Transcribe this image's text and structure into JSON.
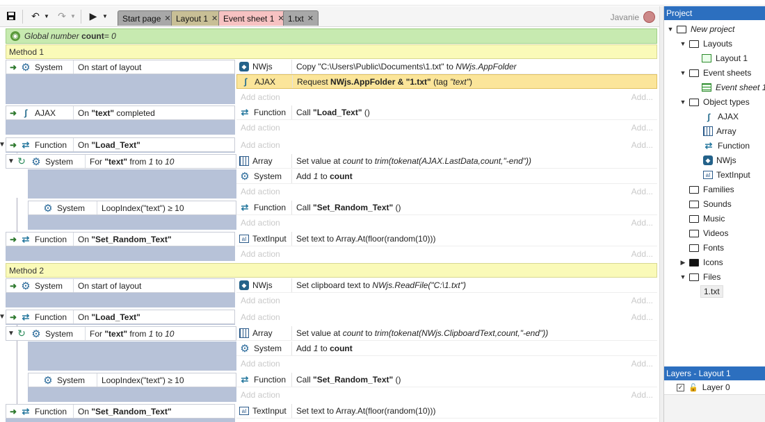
{
  "user": {
    "name": "Javanie"
  },
  "tabs": [
    {
      "label": "Start page"
    },
    {
      "label": "Layout 1"
    },
    {
      "label": "Event sheet 1"
    },
    {
      "label": "1.txt"
    }
  ],
  "global": {
    "prefix": "Global number ",
    "name": "count",
    "suffix": " = 0"
  },
  "add_action": "Add action",
  "add_more": "Add...",
  "groups": {
    "g1": "Method 1",
    "g2": "Method 2"
  },
  "objects": {
    "system": "System",
    "ajax": "AJAX",
    "function": "Function",
    "nwjs": "NWjs",
    "array": "Array",
    "textinput": "TextInput"
  },
  "m1": {
    "e1": {
      "cond": "On start of layout",
      "a1_pre": "Copy \"C:\\Users\\Public\\Documents\\1.txt\" to ",
      "a1_it": "NWjs.AppFolder",
      "a2_pre": "Request ",
      "a2_b": "NWjs.AppFolder & \"1.txt\"",
      "a2_mid": " (tag ",
      "a2_it": "\"text\"",
      "a2_end": ")"
    },
    "e2": {
      "cond_pre": "On ",
      "cond_b": "\"text\"",
      "cond_end": " completed",
      "a1_pre": "Call ",
      "a1_b": "\"Load_Text\"",
      "a1_end": " ()"
    },
    "e3": {
      "cond_pre": "On ",
      "cond_b": "\"Load_Text\""
    },
    "e3s": {
      "cond_pre": "For ",
      "cond_b": "\"text\"",
      "cond_mid": " from ",
      "cond_i1": "1",
      "cond_to": " to ",
      "cond_i2": "10",
      "a1_pre": "Set value at ",
      "a1_it": "count",
      "a1_mid": " to ",
      "a1_it2": "trim(tokenat(AJAX.LastData,count,\"-end\"))",
      "a2_pre": "Add ",
      "a2_it": "1",
      "a2_mid": " to ",
      "a2_b": "count"
    },
    "e3s2": {
      "cond": "LoopIndex(\"text\") ≥ 10",
      "a1_pre": "Call ",
      "a1_b": "\"Set_Random_Text\"",
      "a1_end": " ()"
    },
    "e4": {
      "cond_pre": "On ",
      "cond_b": "\"Set_Random_Text\"",
      "a1": "Set text to Array.At(floor(random(10)))"
    }
  },
  "m2": {
    "e1": {
      "cond": "On start of layout",
      "a1_pre": "Set clipboard text to ",
      "a1_it": "NWjs.ReadFile(\"C:\\1.txt\")"
    },
    "e3": {
      "cond_pre": "On ",
      "cond_b": "\"Load_Text\""
    },
    "e3s": {
      "cond_pre": "For ",
      "cond_b": "\"text\"",
      "cond_mid": " from ",
      "cond_i1": "1",
      "cond_to": " to ",
      "cond_i2": "10",
      "a1_pre": "Set value at ",
      "a1_it": "count",
      "a1_mid": " to ",
      "a1_it2": "trim(tokenat(NWjs.ClipboardText,count,\"-end\"))",
      "a2_pre": "Add ",
      "a2_it": "1",
      "a2_mid": " to ",
      "a2_b": "count"
    },
    "e3s2": {
      "cond": "LoopIndex(\"text\") ≥ 10",
      "a1_pre": "Call ",
      "a1_b": "\"Set_Random_Text\"",
      "a1_end": " ()"
    },
    "e4": {
      "cond_pre": "On ",
      "cond_b": "\"Set_Random_Text\"",
      "a1": "Set text to Array.At(floor(random(10)))"
    }
  },
  "project": {
    "title": "Project",
    "root": "New project",
    "layouts": "Layouts",
    "layout1": "Layout 1",
    "eventsheets": "Event sheets",
    "eventsheet1": "Event sheet 1",
    "objecttypes": "Object types",
    "ajax": "AJAX",
    "array": "Array",
    "function": "Function",
    "nwjs": "NWjs",
    "textinput": "TextInput",
    "families": "Families",
    "sounds": "Sounds",
    "music": "Music",
    "videos": "Videos",
    "fonts": "Fonts",
    "icons": "Icons",
    "files": "Files",
    "file1": "1.txt"
  },
  "layers": {
    "title": "Layers - Layout 1",
    "layer0": "Layer 0"
  }
}
